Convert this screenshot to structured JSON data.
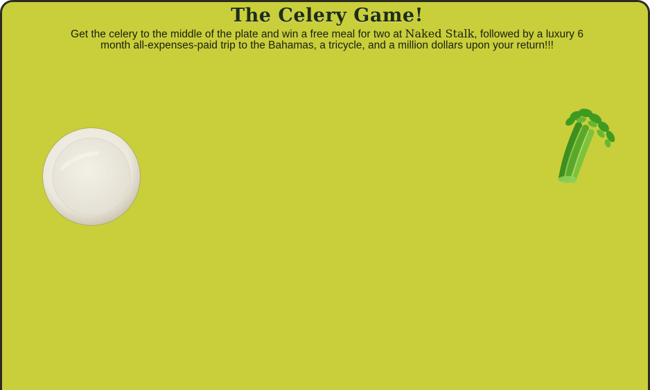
{
  "game": {
    "title": "The Celery Game!",
    "instructions": {
      "before_brand": "Get the celery to the middle of the plate and win a free meal for two at ",
      "brand": "Naked Stalk",
      "after_brand": ", followed by a luxury 6 month all-expenses-paid trip to the Bahamas, a tricycle, and a million dollars upon your return!!!"
    }
  },
  "colors": {
    "background": "#c8cf3a",
    "border": "#2b2b22",
    "text": "#1b1f10"
  },
  "icons": {
    "plate": "plate-icon",
    "celery": "celery-icon"
  }
}
